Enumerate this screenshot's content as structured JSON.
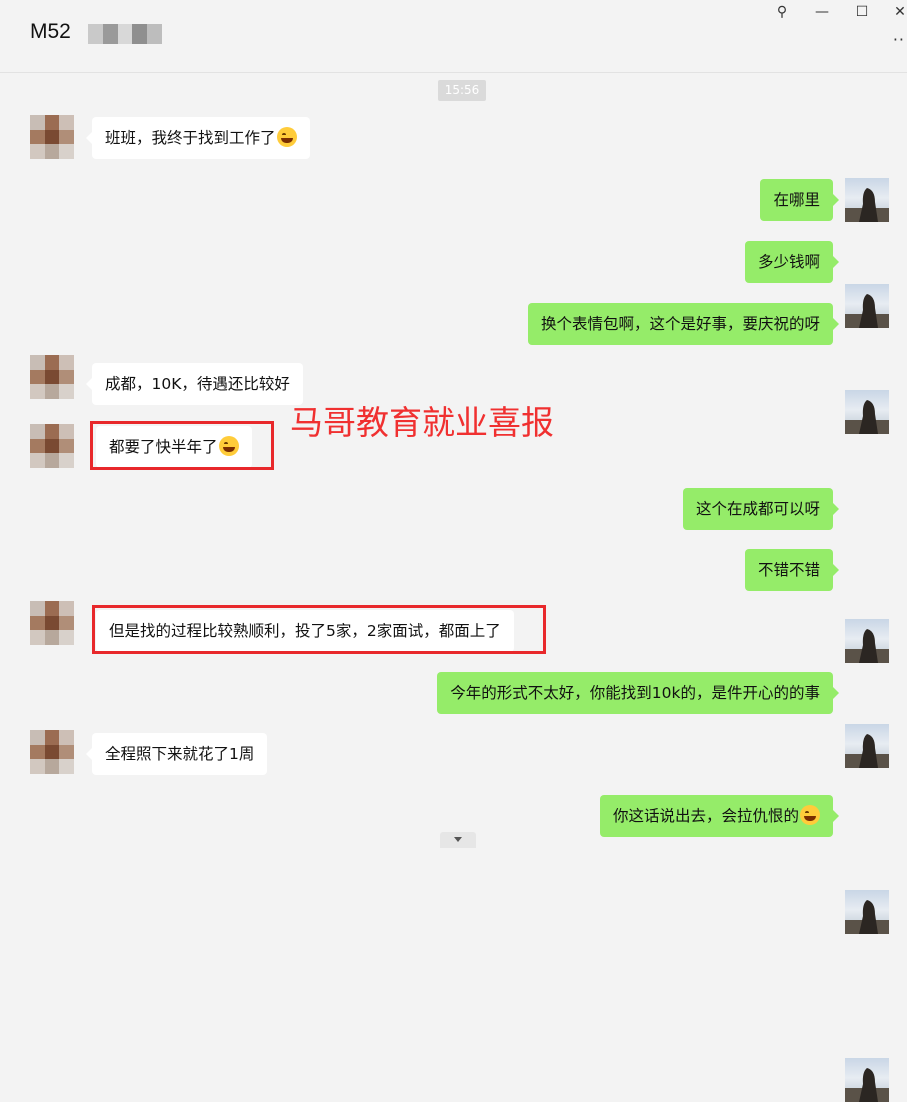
{
  "header": {
    "title": "M52",
    "time": "15:56"
  },
  "overlay_text": "马哥教育就业喜报",
  "messages": [
    {
      "text": "班班，我终于找到工作了",
      "emoji": "laugh-cry-emoji"
    },
    {
      "text": "在哪里"
    },
    {
      "text": "多少钱啊"
    },
    {
      "text": "换个表情包啊，这个是好事，要庆祝的呀"
    },
    {
      "text": "成都，10K，待遇还比较好"
    },
    {
      "text": "都要了快半年了",
      "emoji": "laugh-cry-emoji"
    },
    {
      "text": "这个在成都可以呀"
    },
    {
      "text": "不错不错"
    },
    {
      "text": "但是找的过程比较熟顺利，投了5家，2家面试，都面上了"
    },
    {
      "text": "今年的形式不太好，你能找到10k的，是件开心的的事"
    },
    {
      "text": "全程照下来就花了1周"
    },
    {
      "text": "你这话说出去，会拉仇恨的",
      "emoji": "laugh-cry-emoji"
    }
  ],
  "colors": {
    "self_bubble": "#95ec69",
    "other_bubble": "#ffffff",
    "highlight": "#e8282b",
    "background": "#f3f3f3"
  },
  "icons": [
    "pin-icon",
    "minimize-icon",
    "maximize-icon",
    "close-icon",
    "more-icon",
    "scroll-down-icon"
  ]
}
